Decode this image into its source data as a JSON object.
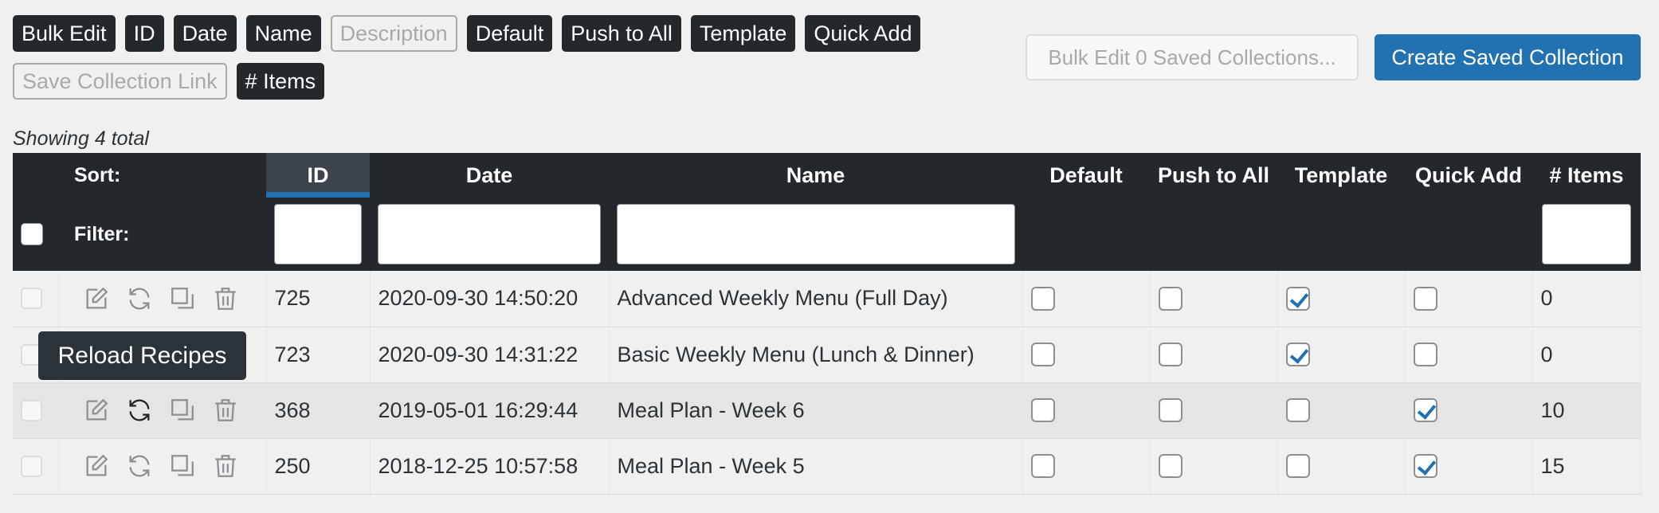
{
  "toolbar": {
    "row1": [
      {
        "label": "Bulk Edit",
        "on": true
      },
      {
        "label": "ID",
        "on": true
      },
      {
        "label": "Date",
        "on": true
      },
      {
        "label": "Name",
        "on": true
      },
      {
        "label": "Description",
        "on": false
      },
      {
        "label": "Default",
        "on": true
      },
      {
        "label": "Push to All",
        "on": true
      },
      {
        "label": "Template",
        "on": true
      },
      {
        "label": "Quick Add",
        "on": true
      }
    ],
    "row2": [
      {
        "label": "Save Collection Link",
        "on": false
      },
      {
        "label": "# Items",
        "on": true
      }
    ],
    "bulk_edit_saved_label": "Bulk Edit 0 Saved Collections...",
    "create_label": "Create Saved Collection"
  },
  "showing_text": "Showing 4 total",
  "table": {
    "sort_label": "Sort:",
    "filter_label": "Filter:",
    "columns": {
      "id": "ID",
      "date": "Date",
      "name": "Name",
      "default": "Default",
      "push": "Push to All",
      "template": "Template",
      "quick_add": "Quick Add",
      "items": "# Items"
    },
    "rows": [
      {
        "id": "725",
        "date": "2020-09-30 14:50:20",
        "name": "Advanced Weekly Menu (Full Day)",
        "default": false,
        "push": false,
        "template": true,
        "quick_add": false,
        "items": "0"
      },
      {
        "id": "723",
        "date": "2020-09-30 14:31:22",
        "name": "Basic Weekly Menu (Lunch & Dinner)",
        "default": false,
        "push": false,
        "template": true,
        "quick_add": false,
        "items": "0"
      },
      {
        "id": "368",
        "date": "2019-05-01 16:29:44",
        "name": "Meal Plan - Week 6",
        "default": false,
        "push": false,
        "template": false,
        "quick_add": true,
        "items": "10"
      },
      {
        "id": "250",
        "date": "2018-12-25 10:57:58",
        "name": "Meal Plan - Week 5",
        "default": false,
        "push": false,
        "template": false,
        "quick_add": true,
        "items": "15"
      }
    ]
  },
  "tooltip": "Reload Recipes",
  "icons": {
    "edit": "edit-icon",
    "reload": "reload-icon",
    "duplicate": "duplicate-icon",
    "delete": "trash-icon"
  },
  "colors": {
    "header_bg": "#23282d",
    "accent": "#2271b1",
    "page_bg": "#f0f0f1"
  }
}
